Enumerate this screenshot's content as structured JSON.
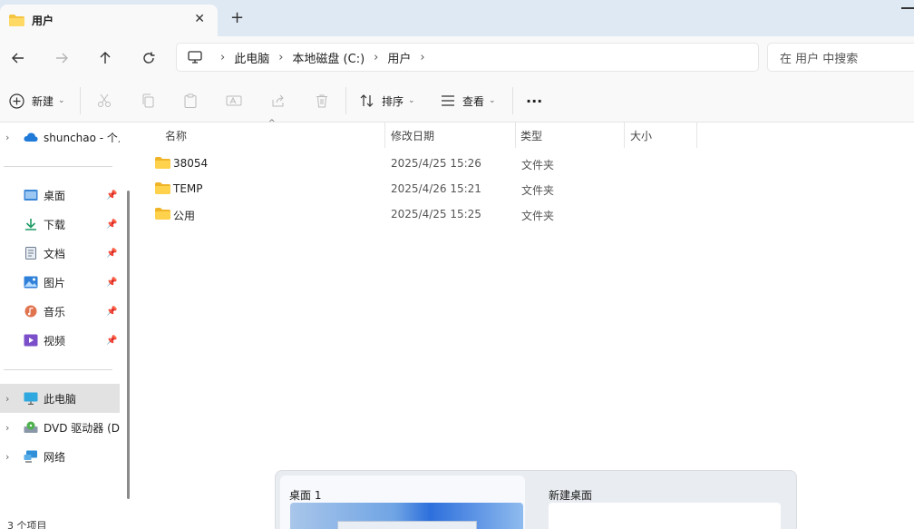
{
  "window": {
    "tab_title": "用户",
    "tab_close": "✕",
    "new_tab": "+"
  },
  "nav": {
    "breadcrumb": [
      "此电脑",
      "本地磁盘 (C:)",
      "用户"
    ],
    "search_placeholder": "在 用户 中搜索"
  },
  "toolbar": {
    "new_label": "新建",
    "sort_label": "排序",
    "view_label": "查看",
    "more_label": "···"
  },
  "sidebar": {
    "onedrive": "shunchao - 个人",
    "quick_access": [
      {
        "label": "桌面",
        "icon": "desktop-icon"
      },
      {
        "label": "下载",
        "icon": "download-icon"
      },
      {
        "label": "文档",
        "icon": "document-icon"
      },
      {
        "label": "图片",
        "icon": "pictures-icon"
      },
      {
        "label": "音乐",
        "icon": "music-icon"
      },
      {
        "label": "视频",
        "icon": "videos-icon"
      }
    ],
    "this_pc": "此电脑",
    "dvd": "DVD 驱动器 (D:",
    "network": "网络"
  },
  "list": {
    "columns": [
      "名称",
      "修改日期",
      "类型",
      "大小"
    ],
    "rows": [
      {
        "name": "38054",
        "date": "2025/4/25 15:26",
        "type": "文件夹"
      },
      {
        "name": "TEMP",
        "date": "2025/4/26 15:21",
        "type": "文件夹"
      },
      {
        "name": "公用",
        "date": "2025/4/25 15:25",
        "type": "文件夹"
      }
    ]
  },
  "status": {
    "item_count": "3 个项目"
  },
  "taskview": {
    "desktop1": "桌面 1",
    "new_desktop": "新建桌面"
  },
  "colors": {
    "folder_yellow": "#f5c542",
    "accent": "#0067c0",
    "tabbar_bg": "#dfe9f4"
  }
}
